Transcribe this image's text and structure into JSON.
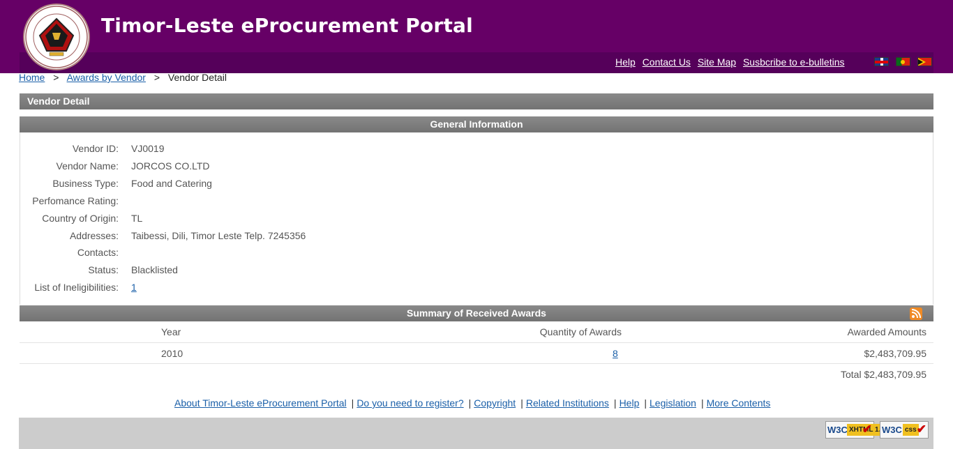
{
  "header": {
    "title": "Timor-Leste eProcurement Portal",
    "logo_text": "REPÚBLICA DEMOCRÁTICA DE TIMOR-LESTE RDTL",
    "links": [
      "Help",
      "Contact Us",
      "Site Map",
      "Susbcribe to e-bulletins"
    ],
    "flags": [
      "uk-flag-icon",
      "portugal-flag-icon",
      "timor-leste-flag-icon"
    ]
  },
  "breadcrumb": {
    "home": "Home",
    "awards": "Awards by Vendor",
    "current": "Vendor Detail",
    "sep": ">"
  },
  "vendor_bar": "Vendor Detail",
  "general": {
    "title": "General Information",
    "fields": [
      {
        "label": "Vendor ID:",
        "value": "VJ0019"
      },
      {
        "label": "Vendor Name:",
        "value": "JORCOS CO.LTD"
      },
      {
        "label": "Business Type:",
        "value": "Food and Catering"
      },
      {
        "label": "Perfomance Rating:",
        "value": ""
      },
      {
        "label": "Country of Origin:",
        "value": "TL"
      },
      {
        "label": "Addresses:",
        "value": "Taibessi, Dili, Timor Leste Telp. 7245356"
      },
      {
        "label": "Contacts:",
        "value": ""
      },
      {
        "label": "Status:",
        "value": "Blacklisted"
      },
      {
        "label": "List of Ineligibilities:",
        "value": "1"
      }
    ]
  },
  "summary": {
    "title": "Summary of Received Awards",
    "columns": [
      "Year",
      "Quantity of Awards",
      "Awarded Amounts"
    ],
    "rows": [
      {
        "year": "2010",
        "quantity": "8",
        "amount": "$2,483,709.95"
      }
    ],
    "total": "Total $2,483,709.95"
  },
  "footer": {
    "links": [
      "About Timor-Leste eProcurement Portal",
      "Do you need to register?",
      "Copyright",
      "Related Institutions",
      "Help",
      "Legislation",
      "More Contents"
    ],
    "pipe": "|",
    "badges": {
      "w3c": "W3C",
      "xhtml": "XHTML 1.0",
      "css": "css",
      "check": "✔"
    }
  }
}
